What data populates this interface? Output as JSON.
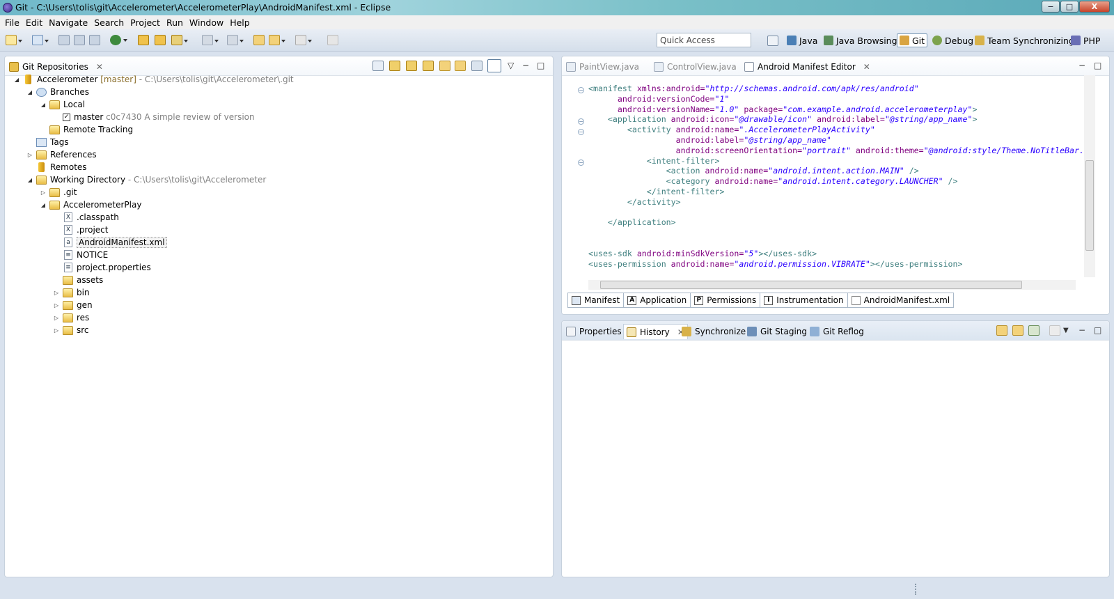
{
  "window": {
    "title": "Git - C:\\Users\\tolis\\git\\Accelerometer\\AccelerometerPlay\\AndroidManifest.xml - Eclipse",
    "min": "−",
    "max": "□",
    "close": "X"
  },
  "menu": [
    "File",
    "Edit",
    "Navigate",
    "Search",
    "Project",
    "Run",
    "Window",
    "Help"
  ],
  "toolbar": {
    "quick_access_placeholder": "Quick Access"
  },
  "perspectives": [
    "Java",
    "Java Browsing",
    "Git",
    "Debug",
    "Team Synchronizing",
    "PHP"
  ],
  "active_perspective": "Git",
  "git_repositories": {
    "tab_label": "Git Repositories",
    "tree": [
      {
        "label": "Accelerometer",
        "branch": "[master]",
        "path": "- C:\\Users\\tolis\\git\\Accelerometer\\.git"
      },
      {
        "label": "Branches"
      },
      {
        "label": "Local"
      },
      {
        "label": "master",
        "detail": "c0c7430 A simple review of version"
      },
      {
        "label": "Remote Tracking"
      },
      {
        "label": "Tags"
      },
      {
        "label": "References"
      },
      {
        "label": "Remotes"
      },
      {
        "label": "Working Directory",
        "path": "- C:\\Users\\tolis\\git\\Accelerometer"
      },
      {
        "label": ".git"
      },
      {
        "label": "AccelerometerPlay"
      },
      {
        "label": ".classpath"
      },
      {
        "label": ".project"
      },
      {
        "label": "AndroidManifest.xml"
      },
      {
        "label": "NOTICE"
      },
      {
        "label": "project.properties"
      },
      {
        "label": "assets"
      },
      {
        "label": "bin"
      },
      {
        "label": "gen"
      },
      {
        "label": "res"
      },
      {
        "label": "src"
      }
    ]
  },
  "editor": {
    "tabs": [
      "PaintView.java",
      "ControlView.java",
      "Android Manifest Editor"
    ],
    "active_tab": "Android Manifest Editor",
    "code": {
      "l1a": "<manifest ",
      "l1b": "xmlns:android=",
      "l1c": "\"http://schemas.android.com/apk/res/android\"",
      "l2a": "      android:versionCode=",
      "l2b": "\"1\"",
      "l3a": "      android:versionName=",
      "l3b": "\"1.0\"",
      "l3c": " package=",
      "l3d": "\"com.example.android.accelerometerplay\"",
      "l3e": ">",
      "l4a": "    <application ",
      "l4b": "android:icon=",
      "l4c": "\"@drawable/icon\"",
      "l4d": " android:label=",
      "l4e": "\"@string/app_name\"",
      "l4f": ">",
      "l5a": "        <activity ",
      "l5b": "android:name=",
      "l5c": "\".AccelerometerPlayActivity\"",
      "l6a": "                  android:label=",
      "l6b": "\"@string/app_name\"",
      "l7a": "                  android:screenOrientation=",
      "l7b": "\"portrait\"",
      "l7c": " android:theme=",
      "l7d": "\"@android:style/Theme.NoTitleBar.",
      "l8": "            <intent-filter>",
      "l9a": "                <action ",
      "l9b": "android:name=",
      "l9c": "\"android.intent.action.MAIN\"",
      "l9d": " />",
      "l10a": "                <category ",
      "l10b": "android:name=",
      "l10c": "\"android.intent.category.LAUNCHER\"",
      "l10d": " />",
      "l11": "            </intent-filter>",
      "l12": "        </activity>",
      "l13": "",
      "l14": "    </application>",
      "l15": "",
      "l16": "",
      "l17a": "<uses-sdk ",
      "l17b": "android:minSdkVersion=",
      "l17c": "\"5\"",
      "l17d": "></uses-sdk>",
      "l18a": "<uses-permission ",
      "l18b": "android:name=",
      "l18c": "\"android.permission.VIBRATE\"",
      "l18d": "></uses-permission>"
    },
    "bottom_tabs": [
      {
        "icon": "",
        "label": "Manifest"
      },
      {
        "icon": "A",
        "label": "Application"
      },
      {
        "icon": "P",
        "label": "Permissions"
      },
      {
        "icon": "I",
        "label": "Instrumentation"
      },
      {
        "icon": "",
        "label": "AndroidManifest.xml"
      }
    ]
  },
  "lower_panel": {
    "tabs": [
      "Properties",
      "History",
      "Synchronize",
      "Git Staging",
      "Git Reflog"
    ],
    "active_tab": "History"
  },
  "colors": {
    "tag": "#3f7f7f",
    "attribute": "#7f007f",
    "value": "#2a00ff",
    "path_grey": "#808080",
    "branch_olive": "#8b6f2c"
  }
}
